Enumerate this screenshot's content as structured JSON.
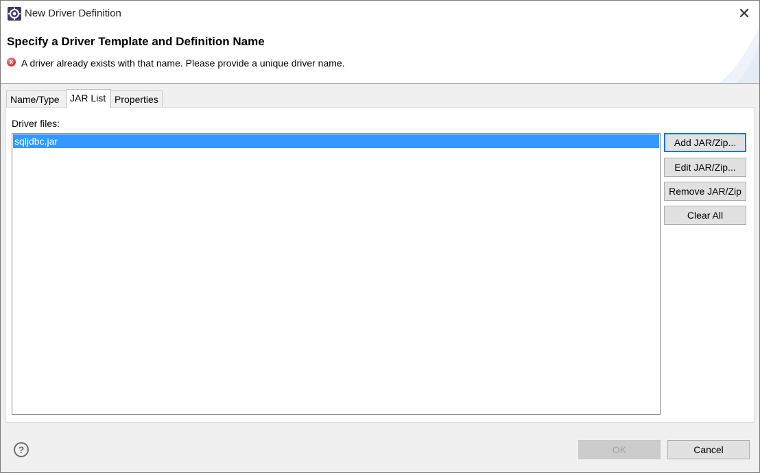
{
  "window": {
    "title": "New Driver Definition",
    "close_glyph": "✕"
  },
  "header": {
    "title": "Specify a Driver Template and Definition Name",
    "error_icon": "error-icon",
    "error_glyph": "x",
    "error_message": "A driver already exists with that name. Please provide a unique driver name."
  },
  "tabs": [
    {
      "label": "Name/Type",
      "active": false
    },
    {
      "label": "JAR List",
      "active": true
    },
    {
      "label": "Properties",
      "active": false
    }
  ],
  "jar_list": {
    "label": "Driver files:",
    "files": [
      {
        "name": "sqljdbc.jar",
        "selected": true
      }
    ]
  },
  "side_buttons": {
    "add": "Add JAR/Zip...",
    "edit": "Edit JAR/Zip...",
    "remove": "Remove JAR/Zip",
    "clear": "Clear All"
  },
  "footer": {
    "help_glyph": "?",
    "ok": "OK",
    "ok_enabled": false,
    "cancel": "Cancel"
  },
  "colors": {
    "selection": "#3399ff",
    "error": "#d9343b",
    "default_button_border": "#0078d7"
  }
}
